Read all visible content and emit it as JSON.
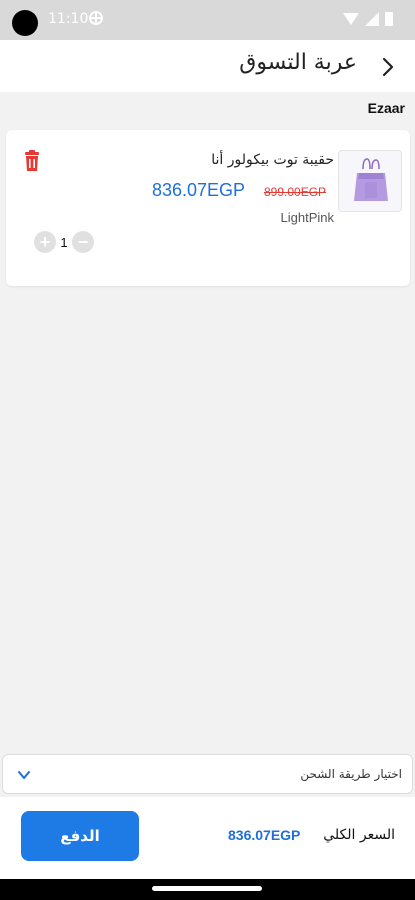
{
  "status_bar": {
    "time": "11:10"
  },
  "header": {
    "title": "عربة التسوق"
  },
  "cart": {
    "seller": "Ezaar",
    "items": [
      {
        "name": "حقيبة توت بيكولور أنا",
        "original_price": "899.00EGP",
        "price": "836.07EGP",
        "color": "LightPink",
        "quantity": "1"
      }
    ]
  },
  "shipping": {
    "placeholder": "اختيار طريقة الشحن"
  },
  "footer": {
    "total_label": "السعر الكلي",
    "total_value": "836.07EGP",
    "pay_label": "الدفع"
  },
  "colors": {
    "accent": "#1e7be6",
    "price": "#1e6fdc",
    "strike": "#e53935",
    "delete": "#e53935"
  }
}
